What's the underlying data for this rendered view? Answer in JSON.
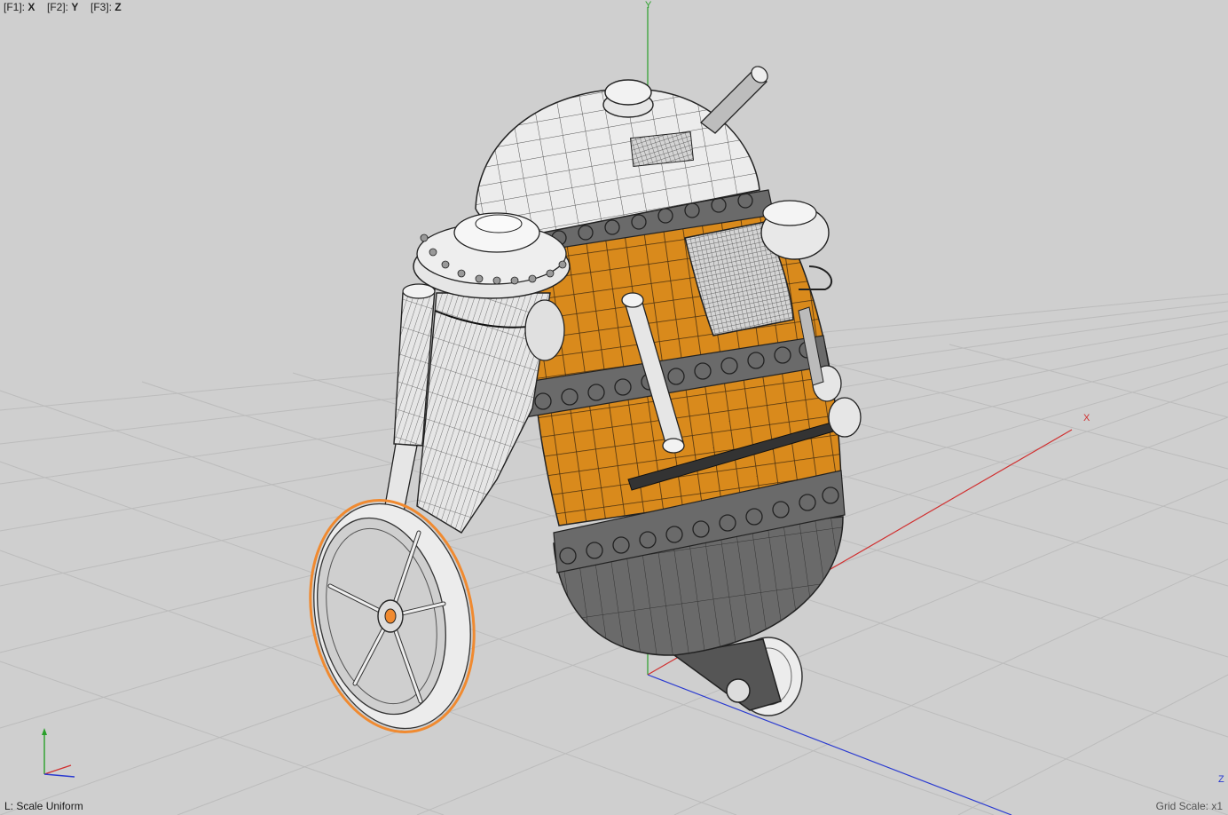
{
  "axis_shortcuts": [
    {
      "key": "[F1]:",
      "axis": "X"
    },
    {
      "key": "[F2]:",
      "axis": "Y"
    },
    {
      "key": "[F3]:",
      "axis": "Z"
    }
  ],
  "axis_labels": {
    "x": "X",
    "y": "Y",
    "z": "Z"
  },
  "status": {
    "tool": "L: Scale Uniform",
    "grid_scale": "Grid Scale: x1"
  },
  "colors": {
    "background": "#cfcfcf",
    "grid": "#b9b9b9",
    "x_axis": "#d03030",
    "y_axis": "#2aa02a",
    "z_axis": "#2a3ad0",
    "body_orange": "#d98a1c",
    "body_dark": "#5e5e5e",
    "shell_light": "#e8e8e8",
    "selection": "#f08a30"
  }
}
